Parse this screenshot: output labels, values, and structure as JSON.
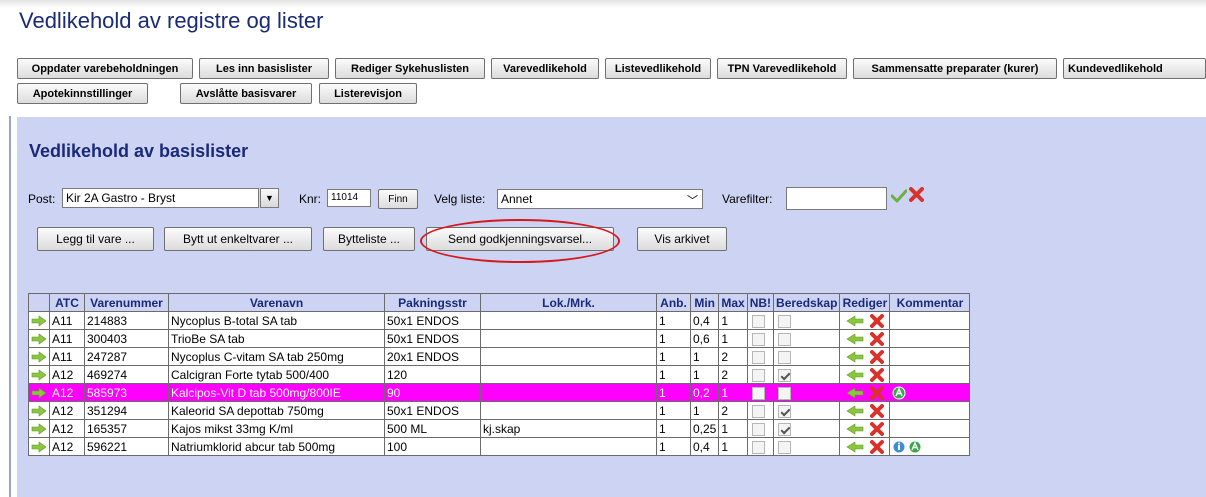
{
  "page": {
    "title": "Vedlikehold av registre og lister"
  },
  "nav": {
    "row1": [
      "Oppdater varebeholdningen",
      "Les inn basislister",
      "Rediger Sykehuslisten",
      "Varevedlikehold",
      "Listevedlikehold",
      "TPN Varevedlikehold",
      "Sammensatte preparater (kurer)",
      "Kundevedlikehold"
    ],
    "row2": [
      "Apotekinnstillinger",
      "Avslåtte basisvarer",
      "Listerevisjon"
    ]
  },
  "section": {
    "title": "Vedlikehold av basislister"
  },
  "filters": {
    "post_label": "Post:",
    "post_value": "Kir 2A Gastro - Bryst",
    "knr_label": "Knr:",
    "knr_value": "11014",
    "finn_label": "Finn",
    "velg_liste_label": "Velg liste:",
    "velg_liste_value": "Annet",
    "varefilter_label": "Varefilter:",
    "varefilter_value": ""
  },
  "actions": [
    "Legg til vare ...",
    "Bytt ut enkeltvarer ...",
    "Bytteliste ...",
    "Send godkjenningsvarsel...",
    "Vis arkivet"
  ],
  "table": {
    "headers": [
      "ATC",
      "Varenummer",
      "Varenavn",
      "Pakningsstr",
      "Lok./Mrk.",
      "Anb.",
      "Min",
      "Max",
      "NB!",
      "Beredskap",
      "Rediger",
      "Kommentar"
    ],
    "rows": [
      {
        "atc": "A11",
        "varenummer": "214883",
        "varenavn": "Nycoplus B-total SA tab",
        "pakning": "50x1 ENDOS",
        "lok": "",
        "anb": "1",
        "min": "0,4",
        "max": "1",
        "nb": false,
        "beredskap": false,
        "highlight": false,
        "comments": []
      },
      {
        "atc": "A11",
        "varenummer": "300403",
        "varenavn": "TrioBe SA tab",
        "pakning": "50x1 ENDOS",
        "lok": "",
        "anb": "1",
        "min": "0,6",
        "max": "1",
        "nb": false,
        "beredskap": false,
        "highlight": false,
        "comments": []
      },
      {
        "atc": "A11",
        "varenummer": "247287",
        "varenavn": "Nycoplus C-vitam SA tab 250mg",
        "pakning": "20x1 ENDOS",
        "lok": "",
        "anb": "1",
        "min": "1",
        "max": "2",
        "nb": false,
        "beredskap": false,
        "highlight": false,
        "comments": []
      },
      {
        "atc": "A12",
        "varenummer": "469274",
        "varenavn": "Calcigran Forte tytab 500/400",
        "pakning": "120",
        "lok": "",
        "anb": "1",
        "min": "1",
        "max": "2",
        "nb": false,
        "beredskap": true,
        "highlight": false,
        "comments": []
      },
      {
        "atc": "A12",
        "varenummer": "585973",
        "varenavn": "Kalcipos-Vit D tab 500mg/800IE",
        "pakning": "90",
        "lok": "",
        "anb": "1",
        "min": "0,2",
        "max": "1",
        "nb": false,
        "beredskap": false,
        "highlight": true,
        "comments": [
          "approve-comment-icon"
        ]
      },
      {
        "atc": "A12",
        "varenummer": "351294",
        "varenavn": "Kaleorid SA depottab 750mg",
        "pakning": "50x1 ENDOS",
        "lok": "",
        "anb": "1",
        "min": "1",
        "max": "2",
        "nb": false,
        "beredskap": true,
        "highlight": false,
        "comments": []
      },
      {
        "atc": "A12",
        "varenummer": "165357",
        "varenavn": "Kajos mikst 33mg K/ml",
        "pakning": "500 ML",
        "lok": "kj.skap",
        "anb": "1",
        "min": "0,25",
        "max": "1",
        "nb": false,
        "beredskap": true,
        "highlight": false,
        "comments": []
      },
      {
        "atc": "A12",
        "varenummer": "596221",
        "varenavn": "Natriumklorid abcur tab 500mg",
        "pakning": "100",
        "lok": "",
        "anb": "1",
        "min": "0,4",
        "max": "1",
        "nb": false,
        "beredskap": false,
        "highlight": false,
        "comments": [
          "info-comment-icon",
          "approve-comment-icon"
        ]
      }
    ]
  },
  "colors": {
    "title": "#1a2a7a",
    "panel_bg": "#cdd4f3",
    "highlight_row": "#ff00ff",
    "annotation_ring": "#d41a1a",
    "arrow_green": "#8cc63f",
    "delete_red": "#d9322b"
  },
  "icons": {
    "row_marker": "arrow-right-icon",
    "filter_apply": "checkmark-icon",
    "filter_clear": "clear-x-icon",
    "edit": "arrow-left-icon",
    "delete": "delete-x-icon"
  }
}
